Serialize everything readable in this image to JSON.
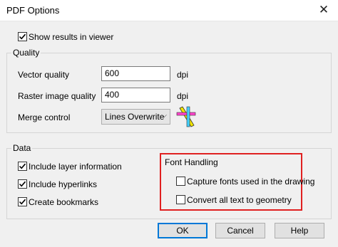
{
  "window": {
    "title": "PDF Options",
    "close_glyph": "✕"
  },
  "show_results": {
    "label": "Show results in viewer",
    "checked": true
  },
  "quality": {
    "group_title": "Quality",
    "vector_label": "Vector quality",
    "vector_value": "600",
    "vector_unit": "dpi",
    "raster_label": "Raster image quality",
    "raster_value": "400",
    "raster_unit": "dpi",
    "merge_label": "Merge control",
    "merge_value": "Lines Overwrite"
  },
  "data": {
    "group_title": "Data",
    "layer_info": {
      "label": "Include layer information",
      "checked": true
    },
    "hyperlinks": {
      "label": "Include hyperlinks",
      "checked": true
    },
    "bookmarks": {
      "label": "Create bookmarks",
      "checked": true
    }
  },
  "font_handling": {
    "title": "Font Handling",
    "capture": {
      "label": "Capture fonts used in the drawing",
      "checked": false
    },
    "convert": {
      "label": "Convert all text to geometry",
      "checked": false
    }
  },
  "buttons": {
    "ok": "OK",
    "cancel": "Cancel",
    "help": "Help"
  },
  "colors": {
    "highlight": "#e02020",
    "accent": "#0078d7"
  }
}
